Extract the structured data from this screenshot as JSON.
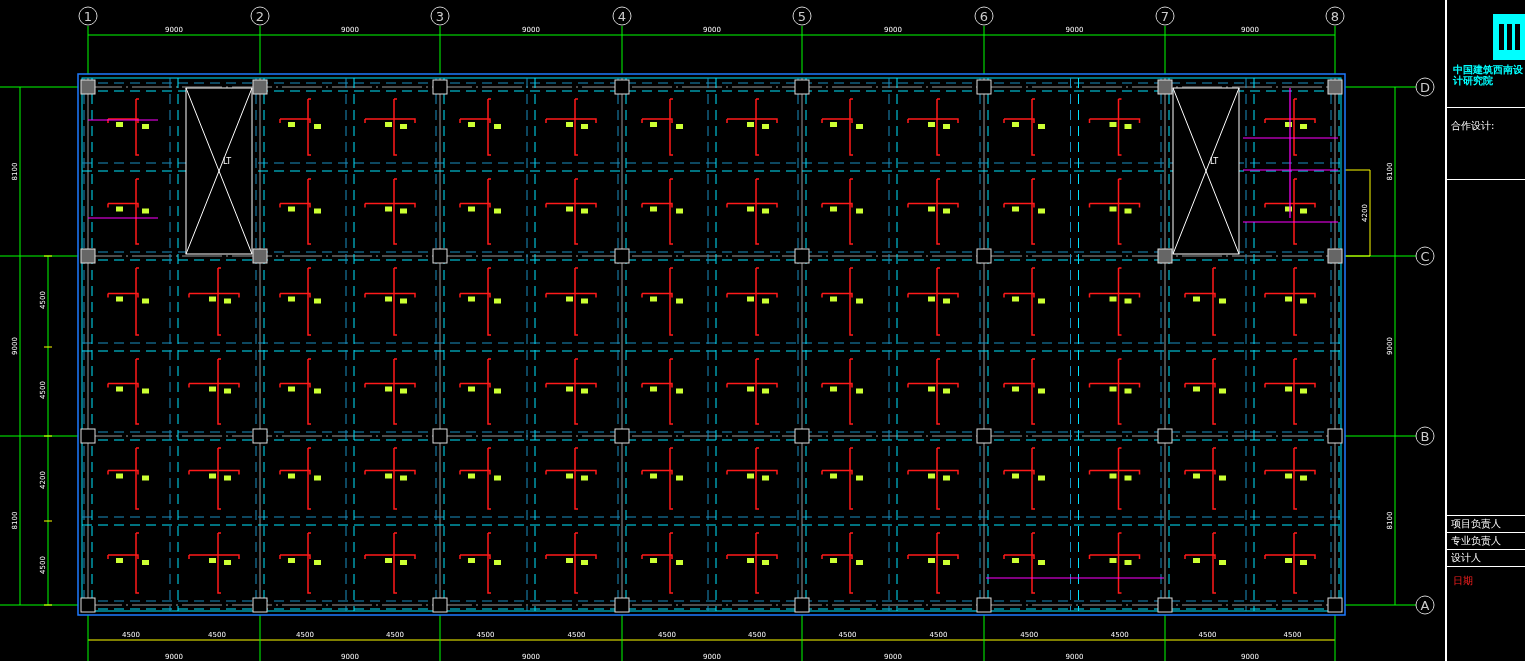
{
  "drawing": {
    "column_axes": [
      {
        "label": "1"
      },
      {
        "label": "2"
      },
      {
        "label": "3"
      },
      {
        "label": "4"
      },
      {
        "label": "5"
      },
      {
        "label": "6"
      },
      {
        "label": "7"
      },
      {
        "label": "8"
      }
    ],
    "row_axes": [
      {
        "label": "D"
      },
      {
        "label": "C"
      },
      {
        "label": "B"
      },
      {
        "label": "A"
      }
    ],
    "top_dimensions": [
      "9000",
      "9000",
      "9000",
      "9000",
      "9000",
      "9000",
      "9000"
    ],
    "bottom_sub_dimensions": [
      "4500",
      "4500",
      "4500",
      "4500",
      "4500",
      "4500",
      "4500",
      "4500",
      "4500",
      "4500",
      "4500",
      "4500",
      "4500",
      "4500"
    ],
    "bottom_dimensions": [
      "9000",
      "9000",
      "9000",
      "9000",
      "9000",
      "9000",
      "9000"
    ],
    "right_dimensions": [
      "8100",
      "9000",
      "8100"
    ],
    "right_sub_dimension": "4200",
    "left_dimensions": [
      "8100",
      "9000",
      "8100"
    ],
    "left_sub_dimensions": [
      "4500",
      "4500",
      "4200",
      "4500"
    ],
    "elevator_shafts": [
      {
        "label": "LT"
      },
      {
        "label": "LT"
      }
    ]
  },
  "title_block": {
    "company": "中国建筑西南设计研究院",
    "cooperation_label": "合作设计:",
    "signatures": [
      "项目负责人",
      "专业负责人",
      "设计人"
    ],
    "date_label": "日期"
  }
}
